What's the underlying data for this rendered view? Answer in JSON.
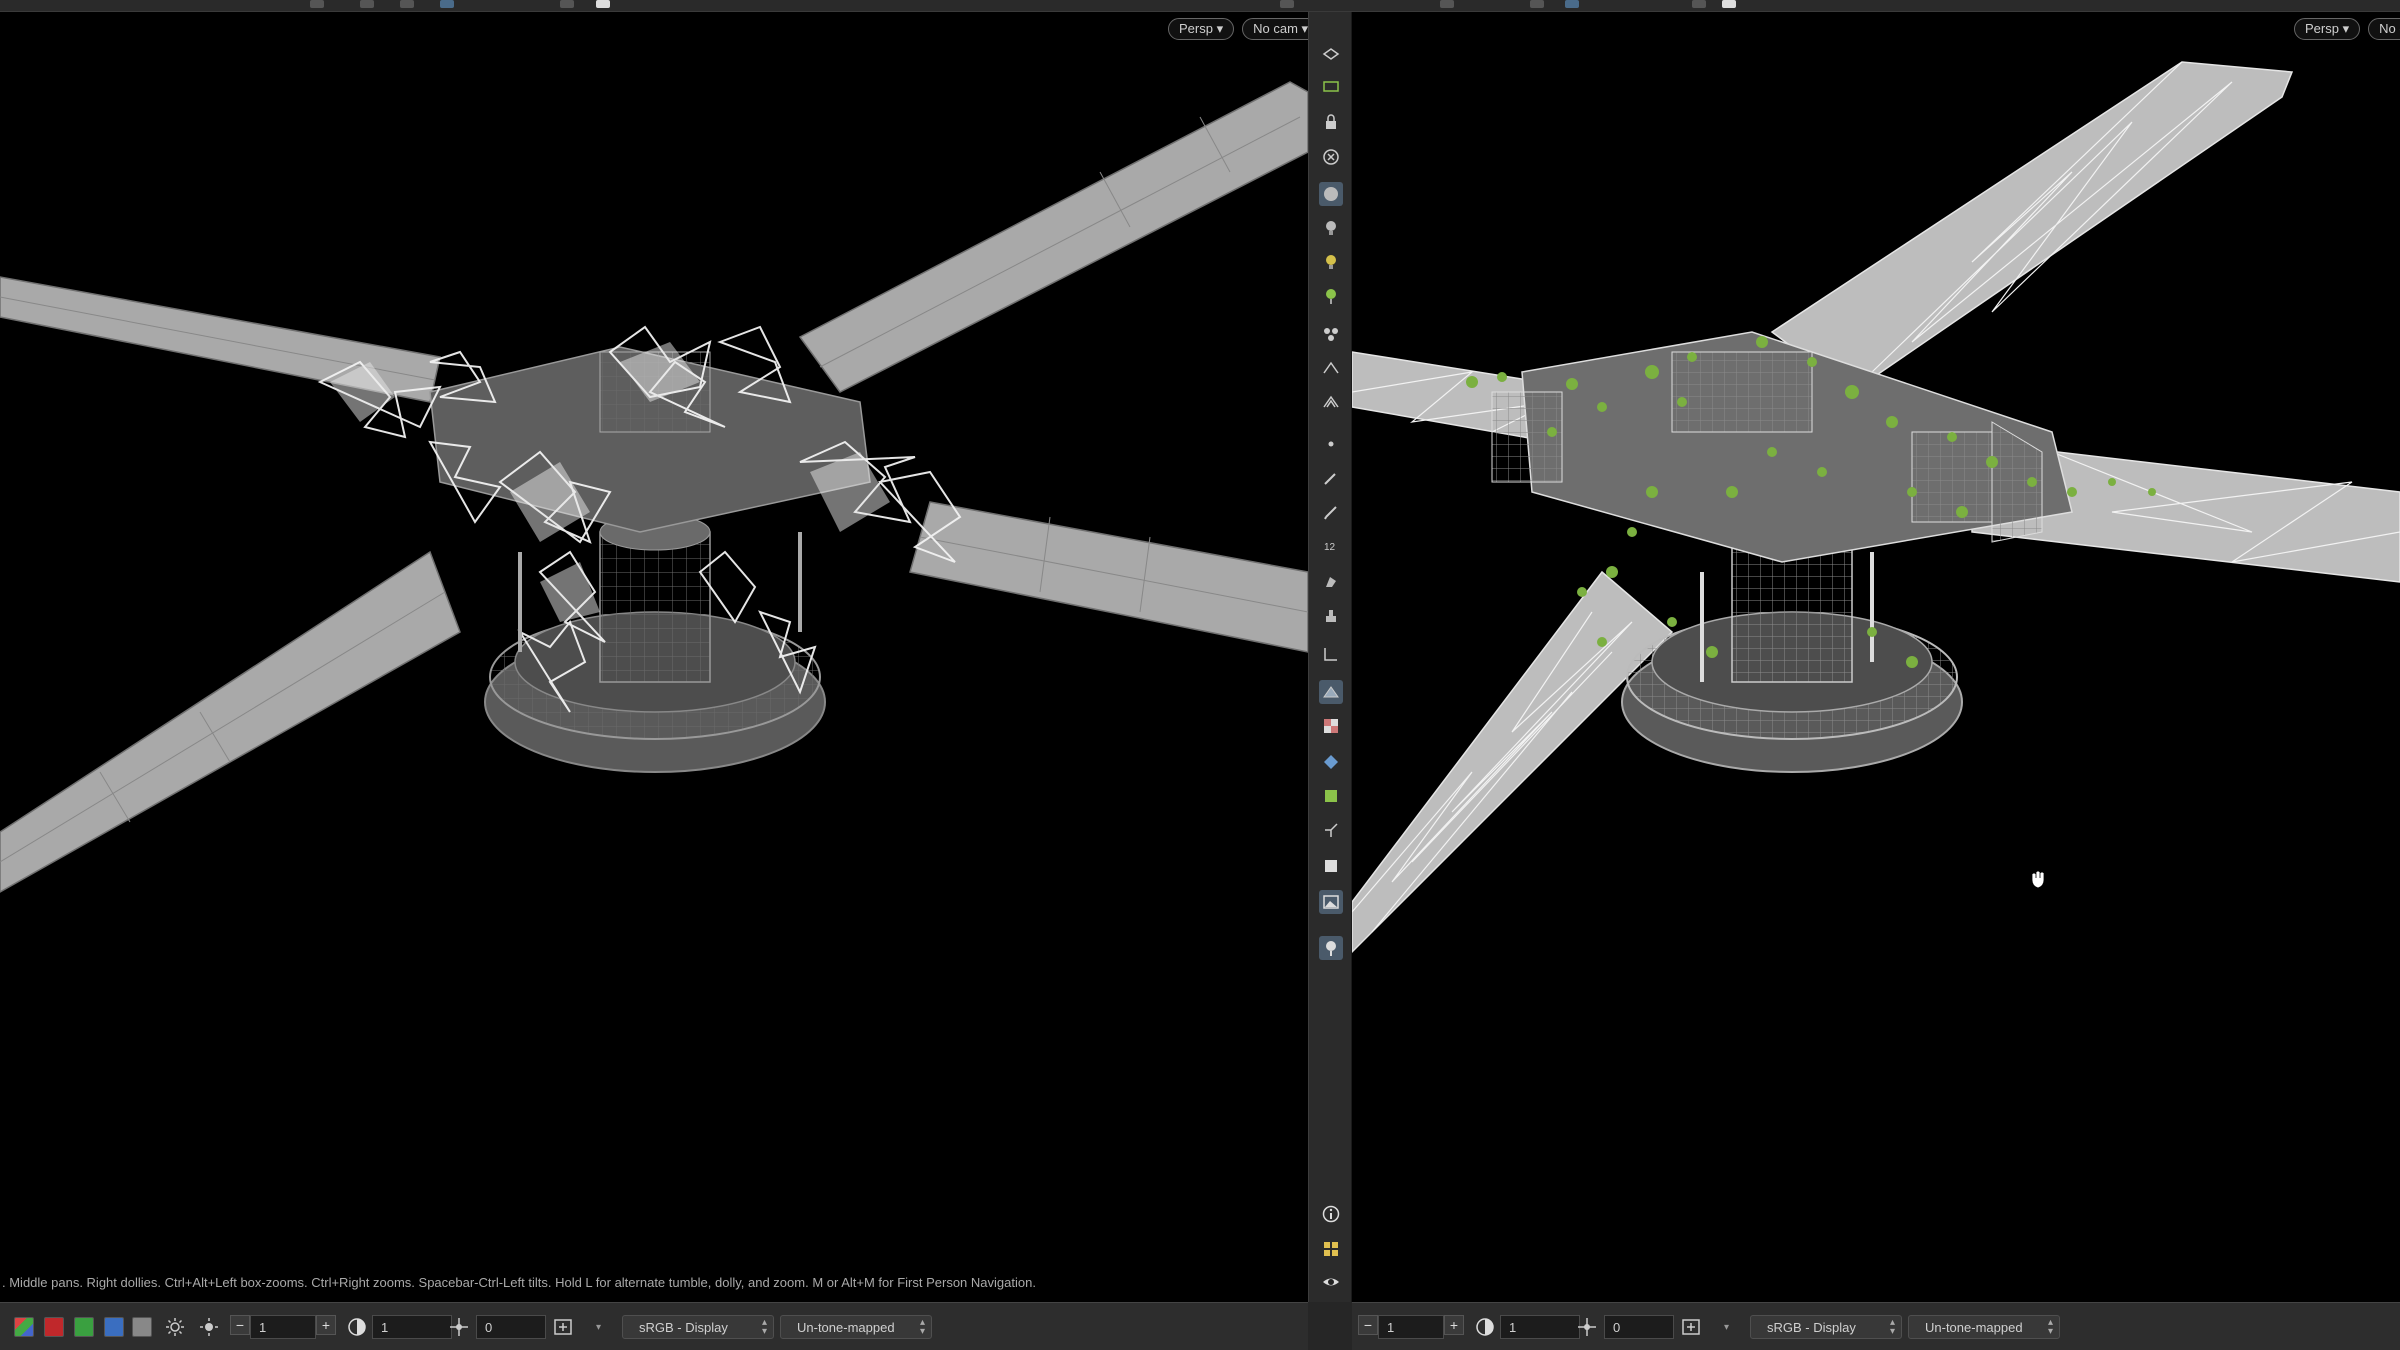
{
  "left_viewport": {
    "camera_menu": "Persp",
    "cam_menu": "No cam",
    "status_text": ". Middle pans. Right dollies. Ctrl+Alt+Left box-zooms. Ctrl+Right zooms. Spacebar-Ctrl-Left tilts. Hold L for alternate tumble, dolly, and zoom. M or Alt+M for First Person Navigation."
  },
  "right_viewport": {
    "camera_menu": "Persp",
    "cam_menu": "No ca"
  },
  "left_toolbar": {
    "minus": "−",
    "plus": "+",
    "field_1": "1",
    "field_2": "1",
    "field_3": "0",
    "color_space": "sRGB - Display",
    "tone_map": "Un-tone-mapped"
  },
  "right_toolbar": {
    "minus": "−",
    "plus": "+",
    "field_1": "1",
    "field_2": "1",
    "field_3": "0",
    "color_space": "sRGB - Display",
    "tone_map": "Un-tone-mapped"
  },
  "shelf": {
    "top_icons": [
      "view-icon",
      "camera-icon",
      "lock-icon",
      "close-circle-icon",
      "display-icon",
      "light-bulb-icon",
      "light-bulb-green-icon",
      "pin-icon",
      "group-icon",
      "snap-icon",
      "snap-multi-icon",
      "point-icon",
      "brush-icon",
      "pen-icon",
      "number-icon",
      "paint-icon",
      "stamp-icon",
      "corner-icon",
      "wire-icon",
      "checker-icon",
      "diamond-icon",
      "texture-icon",
      "axes-icon",
      "square-icon",
      "image-icon",
      "location-icon"
    ],
    "bottom_icons": [
      "info-icon",
      "grid-icon",
      "eye-icon"
    ]
  },
  "colors": {
    "background": "#000000",
    "panel": "#2d2d2d",
    "wire": "#b8b8b8",
    "highlight_green": "#7bb040"
  }
}
